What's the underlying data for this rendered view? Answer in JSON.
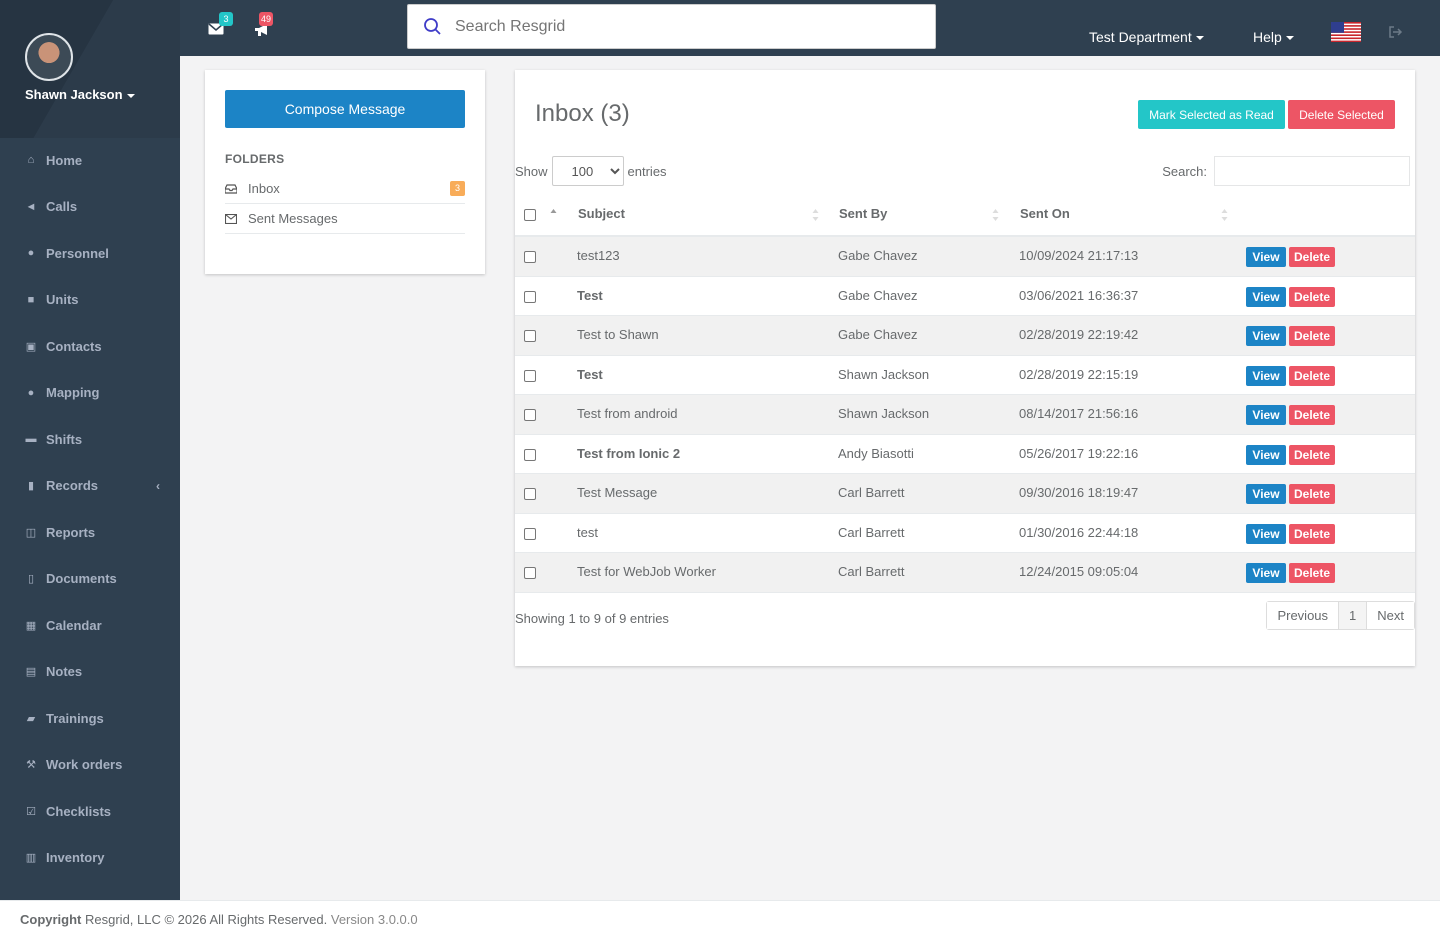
{
  "user": {
    "name": "Shawn Jackson"
  },
  "topbar": {
    "messages_count": "3",
    "calls_count": "49",
    "search_placeholder": "Search Resgrid",
    "department": "Test Department",
    "help": "Help"
  },
  "nav": [
    {
      "label": "Home",
      "icon": "home-icon"
    },
    {
      "label": "Calls",
      "icon": "bullhorn-icon"
    },
    {
      "label": "Personnel",
      "icon": "user-icon"
    },
    {
      "label": "Units",
      "icon": "truck-icon"
    },
    {
      "label": "Contacts",
      "icon": "contact-card-icon"
    },
    {
      "label": "Mapping",
      "icon": "map-marker-icon"
    },
    {
      "label": "Shifts",
      "icon": "briefcase-icon"
    },
    {
      "label": "Records",
      "icon": "file-icon"
    },
    {
      "label": "Reports",
      "icon": "reports-icon"
    },
    {
      "label": "Documents",
      "icon": "document-icon"
    },
    {
      "label": "Calendar",
      "icon": "calendar-icon"
    },
    {
      "label": "Notes",
      "icon": "notes-icon"
    },
    {
      "label": "Trainings",
      "icon": "book-icon"
    },
    {
      "label": "Work orders",
      "icon": "wrench-icon"
    },
    {
      "label": "Checklists",
      "icon": "checklist-icon"
    },
    {
      "label": "Inventory",
      "icon": "barcode-icon"
    }
  ],
  "folders": {
    "compose_label": "Compose Message",
    "title": "FOLDERS",
    "items": [
      {
        "label": "Inbox",
        "badge": "3"
      },
      {
        "label": "Sent Messages"
      }
    ]
  },
  "inbox": {
    "title": "Inbox (3)",
    "mark_read_label": "Mark Selected as Read",
    "delete_selected_label": "Delete Selected",
    "show_label": "Show",
    "entries_label": "entries",
    "page_size": "100",
    "search_label": "Search:",
    "columns": [
      "Subject",
      "Sent By",
      "Sent On"
    ],
    "rows": [
      {
        "subject": "test123",
        "sent_by": "Gabe Chavez",
        "sent_on": "10/09/2024 21:17:13",
        "unread": false
      },
      {
        "subject": "Test",
        "sent_by": "Gabe Chavez",
        "sent_on": "03/06/2021 16:36:37",
        "unread": true
      },
      {
        "subject": "Test to Shawn",
        "sent_by": "Gabe Chavez",
        "sent_on": "02/28/2019 22:19:42",
        "unread": false
      },
      {
        "subject": "Test",
        "sent_by": "Shawn Jackson",
        "sent_on": "02/28/2019 22:15:19",
        "unread": true
      },
      {
        "subject": "Test from android",
        "sent_by": "Shawn Jackson",
        "sent_on": "08/14/2017 21:56:16",
        "unread": false
      },
      {
        "subject": "Test from Ionic 2",
        "sent_by": "Andy Biasotti",
        "sent_on": "05/26/2017 19:22:16",
        "unread": true
      },
      {
        "subject": "Test Message",
        "sent_by": "Carl Barrett",
        "sent_on": "09/30/2016 18:19:47",
        "unread": false
      },
      {
        "subject": "test",
        "sent_by": "Carl Barrett",
        "sent_on": "01/30/2016 22:44:18",
        "unread": false
      },
      {
        "subject": "Test for WebJob Worker",
        "sent_by": "Carl Barrett",
        "sent_on": "12/24/2015 09:05:04",
        "unread": false
      }
    ],
    "view_label": "View",
    "delete_label": "Delete",
    "showing_text": "Showing 1 to 9 of 9 entries",
    "pager": {
      "previous": "Previous",
      "current": "1",
      "next": "Next"
    }
  },
  "footer": {
    "copyright_label": "Copyright",
    "copyright_text": " Resgrid, LLC © 2026 All Rights Reserved.",
    "version": " Version 3.0.0.0"
  },
  "colors": {
    "sidebar": "#2f4050",
    "primary": "#1c84c6",
    "info": "#23c6c8",
    "danger": "#ed5565",
    "warning": "#f8ac59"
  }
}
